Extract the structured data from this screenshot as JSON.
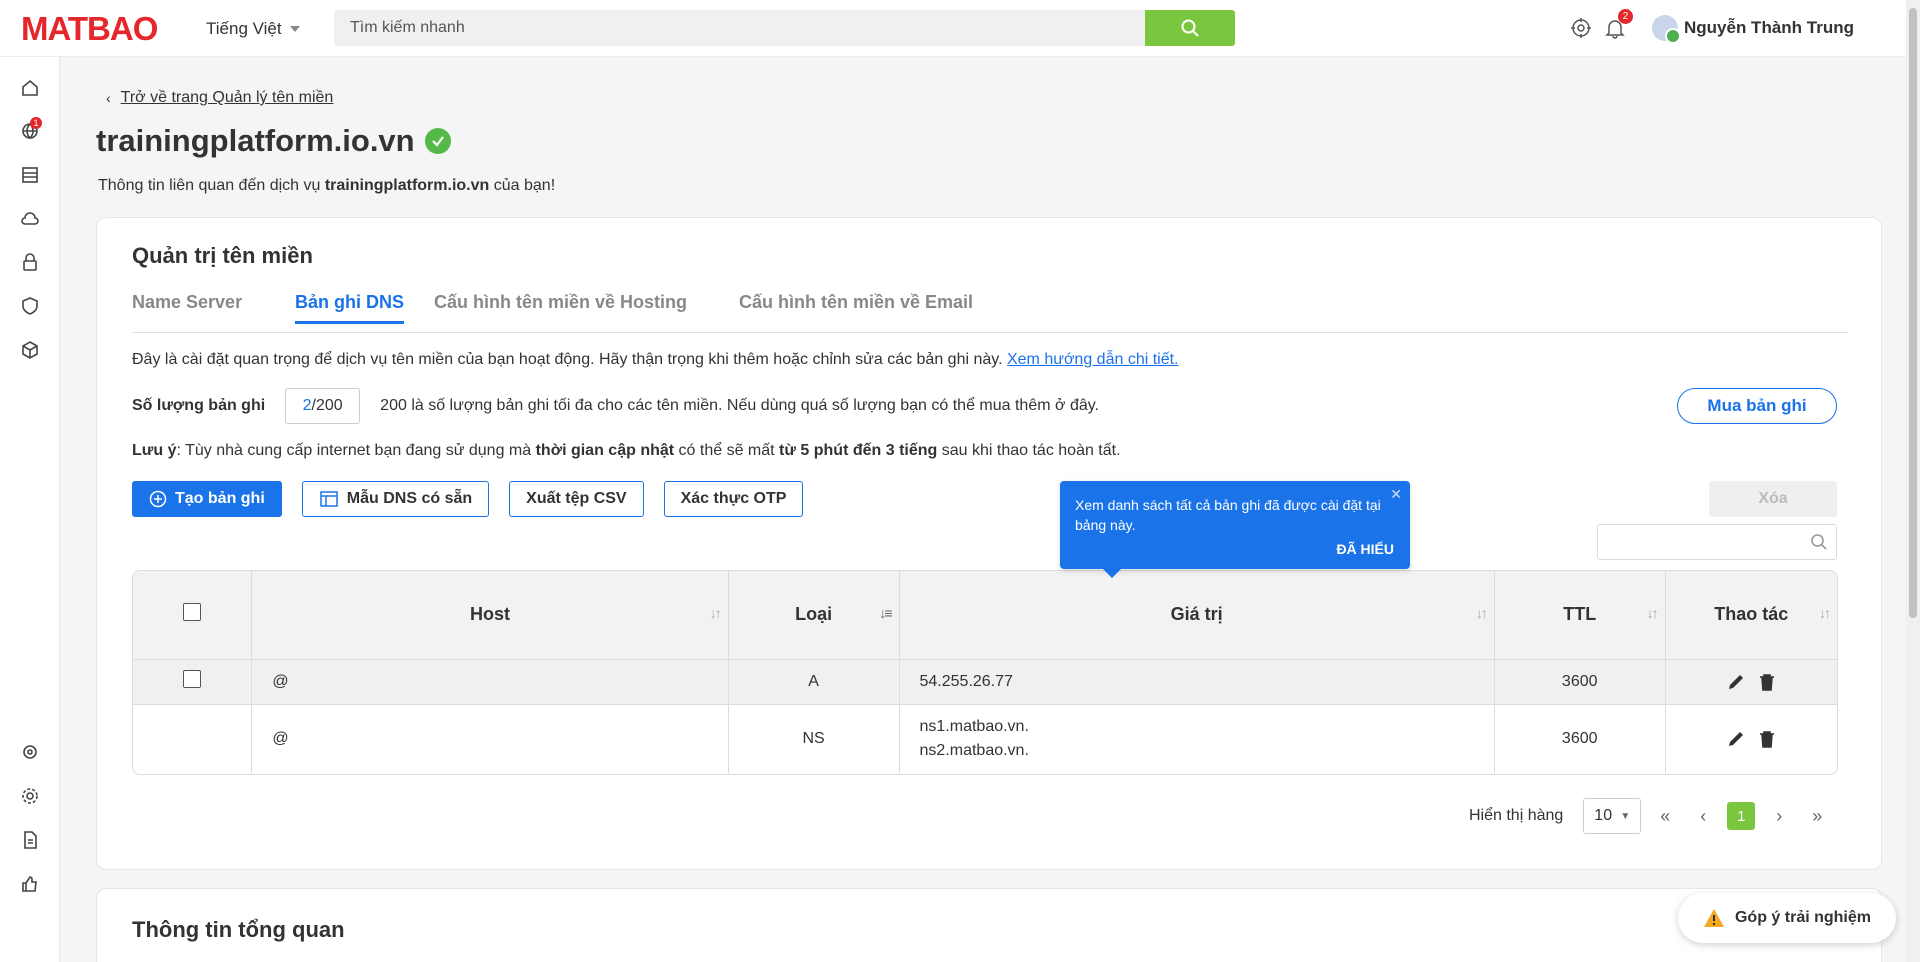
{
  "header": {
    "logo": "MATBAO",
    "language": "Tiếng Việt",
    "search_placeholder": "Tìm kiếm nhanh",
    "notification_count": "2",
    "user_name": "Nguyễn Thành Trung"
  },
  "sidebar": {
    "globe_badge": "1",
    "items": [
      "home-icon",
      "globe-icon",
      "server-icon",
      "cloud-icon",
      "lock-icon",
      "shield-icon",
      "box-icon",
      "support-icon",
      "settings-icon",
      "document-icon",
      "thumbs-up-icon"
    ]
  },
  "page": {
    "back_link": "Trở về trang Quản lý tên miền",
    "domain": "trainingplatform.io.vn",
    "subtitle_prefix": "Thông tin liên quan đến dịch vụ",
    "subtitle_domain": "trainingplatform.io.vn",
    "subtitle_suffix": "của bạn!"
  },
  "card": {
    "title": "Quản trị tên miền",
    "tabs": [
      {
        "label": "Name Server",
        "active": false
      },
      {
        "label": "Bản ghi DNS",
        "active": true
      },
      {
        "label": "Cấu hình tên miền về Hosting",
        "active": false
      },
      {
        "label": "Cấu hình tên miền về Email",
        "active": false
      }
    ],
    "notice_text": "Đây là cài đặt quan trọng để dịch vụ tên miền của bạn hoạt động. Hãy thận trọng khi thêm hoặc chỉnh sửa các bản ghi này.",
    "notice_link": "Xem hướng dẫn chi tiết.",
    "count_label": "Số lượng bản ghi",
    "count_current": "2",
    "count_max": "/200",
    "count_desc": "200 là số lượng bản ghi tối đa cho các tên miền. Nếu dùng quá số lượng bạn có thể mua thêm ở đây.",
    "buy_button": "Mua bản ghi",
    "note_label": "Lưu ý",
    "note_text_1": ": Tùy nhà cung cấp internet bạn đang sử dụng mà",
    "note_bold_1": "thời gian cập nhật",
    "note_text_2": "có thể sẽ mất",
    "note_bold_2": "từ 5 phút đến 3 tiếng",
    "note_text_3": "sau khi thao tác hoàn tất.",
    "buttons": {
      "create": "Tạo bản ghi",
      "templates": "Mẫu DNS có sẵn",
      "export": "Xuất tệp CSV",
      "otp": "Xác thực OTP",
      "delete": "Xóa"
    },
    "tooltip": {
      "text": "Xem danh sách tất cả bản ghi đã được cài đặt tại bảng này.",
      "ok": "ĐÃ HIỂU"
    },
    "table": {
      "columns": [
        "Host",
        "Loại",
        "Giá trị",
        "TTL",
        "Thao tác"
      ],
      "rows": [
        {
          "host": "@",
          "type": "A",
          "value_1": "54.255.26.77",
          "value_2": "",
          "ttl": "3600"
        },
        {
          "host": "@",
          "type": "NS",
          "value_1": "ns1.matbao.vn.",
          "value_2": "ns2.matbao.vn.",
          "ttl": "3600"
        }
      ]
    },
    "pager": {
      "label": "Hiển thị hàng",
      "page_size": "10",
      "current_page": "1"
    }
  },
  "card2": {
    "title": "Thông tin tổng quan"
  },
  "feedback": "Góp ý trải nghiệm"
}
